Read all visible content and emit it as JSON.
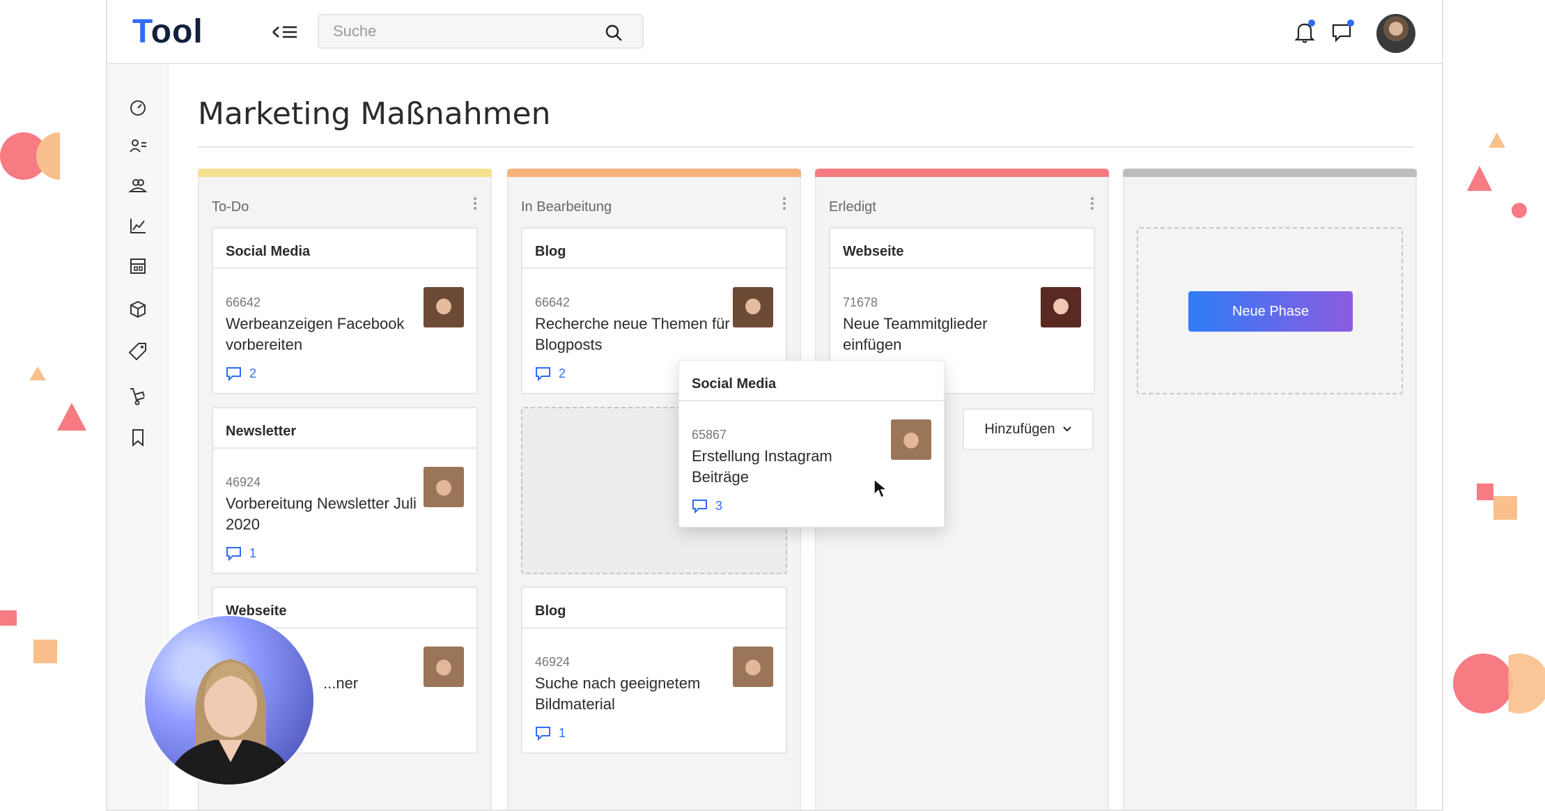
{
  "app": {
    "logo_first": "T",
    "logo_rest": "ool"
  },
  "search": {
    "placeholder": "Suche"
  },
  "page": {
    "title": "Marketing Maßnahmen"
  },
  "columns": [
    {
      "title": "To-Do",
      "accent": "#f3e08f",
      "cards": [
        {
          "category": "Social Media",
          "id": "66642",
          "text": "Werbeanzeigen Facebook vorbereiten",
          "comments": "2"
        },
        {
          "category": "Newsletter",
          "id": "46924",
          "text": "Vorbereitung Newsletter Juli 2020",
          "comments": "1"
        },
        {
          "category": "Webseite",
          "id": "",
          "text": "...ner",
          "comments": ""
        }
      ]
    },
    {
      "title": "In Bearbeitung",
      "accent": "#f5b27a",
      "cards": [
        {
          "category": "Blog",
          "id": "66642",
          "text": "Recherche neue Themen für Blogposts",
          "comments": "2"
        },
        {
          "category": "Blog",
          "id": "46924",
          "text": "Suche nach geeignetem Bildmaterial",
          "comments": "1"
        }
      ]
    },
    {
      "title": "Erledigt",
      "accent": "#f47a7f",
      "cards": [
        {
          "category": "Webseite",
          "id": "71678",
          "text": "Neue Teammitglieder einfügen",
          "comments": ""
        }
      ],
      "add_label": "Hinzufügen"
    },
    {
      "title": "",
      "accent": "#bdbdbd",
      "new_phase_label": "Neue Phase"
    }
  ],
  "dragged_card": {
    "category": "Social Media",
    "id": "65867",
    "text": "Erstellung Instagram Beiträge",
    "comments": "3"
  },
  "colors": {
    "primary": "#2f6bf6",
    "gradient_start": "#2f7df7",
    "gradient_end": "#8d5be0",
    "deco_pink": "#f77b83",
    "deco_orange": "#f9c08d"
  },
  "icons": [
    "menu-collapse-icon",
    "search-icon",
    "bell-icon",
    "chat-icon",
    "dashboard-icon",
    "contacts-icon",
    "team-icon",
    "chart-icon",
    "layout-icon",
    "box-icon",
    "tag-icon",
    "cart-icon",
    "bookmark-icon",
    "comment-icon",
    "chevron-down-icon",
    "cursor-icon"
  ]
}
